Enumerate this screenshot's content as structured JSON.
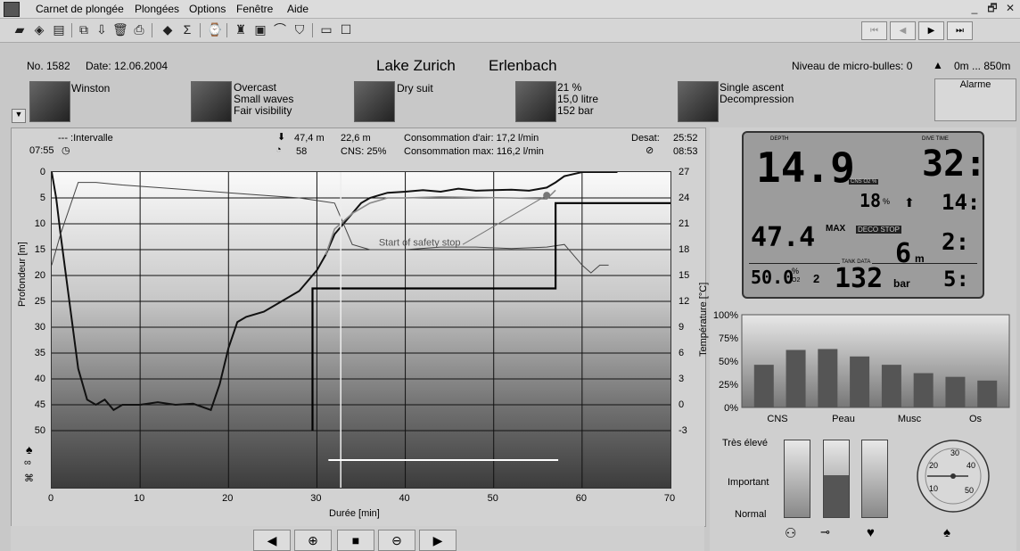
{
  "menu": {
    "items": [
      "Carnet de plongée",
      "Plongées",
      "Options",
      "Fenêtre",
      "Aide"
    ],
    "win_min": "_",
    "win_restore": "🗗",
    "win_close": "✕"
  },
  "toolbar": {
    "icons": [
      "book-icon",
      "open-icon",
      "print-icon",
      "copy-icon",
      "import-icon",
      "delete-icon",
      "export-icon",
      "logbook-icon",
      "sum-icon",
      "watch-icon",
      "diver-icon",
      "card-icon",
      "plan-icon",
      "shield-icon",
      "panel-icon",
      "window-icon"
    ],
    "nav": [
      "⏮",
      "◀",
      "▶",
      "⏭"
    ]
  },
  "dive": {
    "no": "No. 1582",
    "date": "Date: 12.06.2004",
    "location": "Lake Zurich",
    "site": "Erlenbach",
    "microbubble": "Niveau de micro-bulles: 0",
    "altitude": "0m ... 850m",
    "buddy": "Winston",
    "weather": [
      "Overcast",
      "Small waves",
      "Fair visibility"
    ],
    "suit": "Dry suit",
    "gas": [
      "21 %",
      "15,0 litre",
      "152 bar"
    ],
    "ascent": [
      "Single ascent",
      "Decompression"
    ],
    "alarm": "Alarme"
  },
  "profile_header": {
    "interval_label": "--- :Intervalle",
    "interval_time": "07:55",
    "maxdepth": "47,4 m",
    "avgdepth": "22,6 m",
    "divetime": "58",
    "cns": "CNS: 25%",
    "air_cons": "Consommation d'air: 17,2 l/min",
    "air_max": "Consommation max: 116,2 l/min",
    "desat_label": "Desat:",
    "desat_time": "25:52",
    "nofly_time": "08:53"
  },
  "colors": {
    "plot_bg": "#f4f4f4",
    "lcd": "#9c9c9c",
    "bar": "#555555"
  },
  "chart_data": [
    {
      "type": "line",
      "xlabel": "Durée [min]",
      "ylabel": "Profondeur [m]",
      "y2label": "Température [°C]",
      "xlim": [
        0,
        70
      ],
      "ylim": [
        50,
        0
      ],
      "y2lim": [
        -3,
        27
      ],
      "xticks": [
        "0",
        "10",
        "20",
        "30",
        "40",
        "50",
        "60",
        "70"
      ],
      "yticks": [
        "0",
        "5",
        "10",
        "15",
        "20",
        "25",
        "30",
        "35",
        "40",
        "45",
        "50"
      ],
      "y2ticks": [
        "27",
        "24",
        "21",
        "18",
        "15",
        "12",
        "9",
        "6",
        "3",
        "0",
        "-3"
      ],
      "annotation": "Start of safety stop",
      "series": [
        {
          "x": [
            0,
            0.5,
            1,
            2,
            3,
            4,
            5,
            6,
            7,
            8,
            10,
            12,
            14,
            16,
            18,
            19,
            20,
            21,
            22,
            24,
            26,
            28,
            30,
            31,
            32,
            33,
            34,
            35,
            36,
            37,
            38,
            40,
            42,
            44,
            46,
            48,
            50,
            52,
            54,
            56,
            57,
            58,
            60,
            62,
            64
          ],
          "y": [
            0,
            5,
            12,
            25,
            38,
            44,
            45,
            44,
            46,
            45,
            45,
            44.5,
            45,
            44.8,
            46,
            41,
            34,
            29,
            28,
            27,
            25,
            23,
            19,
            16,
            12,
            10,
            8,
            6,
            5,
            4.5,
            4,
            3.8,
            3.5,
            3.8,
            3.2,
            3.6,
            3.5,
            3.4,
            3.6,
            3.0,
            2.0,
            0.8,
            0,
            0,
            0
          ]
        },
        {
          "x": [
            0,
            1,
            3,
            5,
            8,
            12,
            16,
            20,
            24,
            28,
            30,
            32,
            34,
            36,
            38,
            40,
            44,
            48,
            52,
            56,
            58,
            60,
            61,
            62,
            63
          ],
          "y": [
            18,
            12,
            2,
            2,
            2.5,
            3,
            3.5,
            4,
            4.5,
            5,
            5.5,
            6,
            14,
            15,
            15,
            15,
            14.5,
            14.5,
            14.8,
            14.5,
            14,
            18,
            19.5,
            18,
            18
          ]
        },
        {
          "x": [
            29.5,
            29.5,
            31,
            35,
            40,
            45,
            50,
            55,
            57,
            57,
            70
          ],
          "y": [
            50,
            22.5,
            22.5,
            22.5,
            22.5,
            22.5,
            22.5,
            22.5,
            22.5,
            6,
            6
          ]
        },
        {
          "x": [
            31,
            32,
            34,
            36,
            38,
            40,
            44,
            48,
            52,
            56,
            57
          ],
          "y": [
            16,
            11,
            8,
            6,
            5,
            5,
            4.8,
            4.9,
            5,
            5.2,
            3.5
          ]
        }
      ]
    },
    {
      "type": "bar",
      "categories": [
        "CNS",
        "Peau",
        "Musc",
        "Os"
      ],
      "values": [
        46,
        62,
        63,
        55,
        46,
        37,
        33,
        29
      ],
      "ylim": [
        0,
        100
      ],
      "yticks": [
        "100%",
        "75%",
        "50%",
        "25%",
        "0%"
      ]
    }
  ],
  "lcd": {
    "depth_label": "DEPTH",
    "time_label": "DIVE TIME",
    "depth": "14.9",
    "time": "32:",
    "cns_label": "CNS O2 %",
    "cns": "18",
    "cns_unit": "%",
    "ascent_val": "14:",
    "maxdepth": "47.4",
    "max_label": "MAX",
    "deco_label": "DECO STOP",
    "deco_depth": "6",
    "deco_unit": "m",
    "deco_time": "2:",
    "tank_label": "TANK DATA",
    "o2": "50.0",
    "o2_unit": "%",
    "o2_sub": "O2",
    "tank_no": "2",
    "pressure": "132",
    "pressure_unit": "bar",
    "remaining": "5:"
  },
  "saturation": {
    "labels": [
      "Très élevé",
      "Important",
      "Normal"
    ],
    "gauge_fill": [
      0,
      0.55,
      0
    ]
  },
  "compass": {
    "labels": [
      "30",
      "20",
      "40",
      "10",
      "50"
    ]
  }
}
